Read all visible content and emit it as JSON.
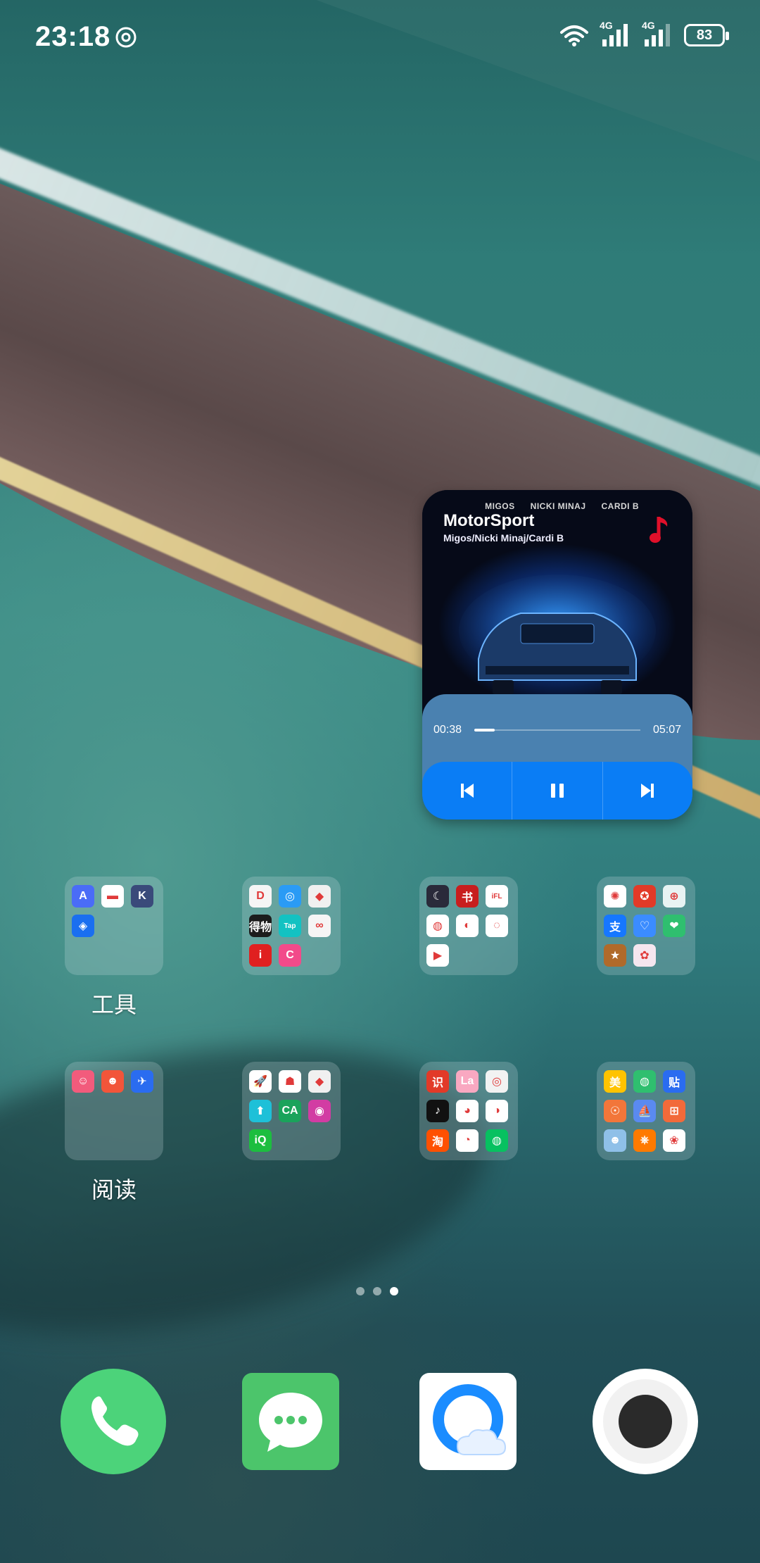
{
  "status_bar": {
    "time": "23:18",
    "network_label_1": "4G",
    "network_label_2": "4G",
    "battery": "83"
  },
  "music_widget": {
    "album_artists": [
      "MIGOS",
      "NICKI MINAJ",
      "CARDI B"
    ],
    "title": "MotorSport",
    "artist": "Migos/Nicki Minaj/Cardi B",
    "elapsed": "00:38",
    "duration": "05:07",
    "progress_fraction": 0.124,
    "accent_color": "#0a7df5"
  },
  "folders": [
    {
      "label": "工具",
      "icons": [
        {
          "name": "app-store-icon",
          "color": "#4a6cf7",
          "glyph": "A"
        },
        {
          "name": "card-app-icon",
          "color": "#ffffff",
          "glyph": "▬"
        },
        {
          "name": "k-app-icon",
          "color": "#3a4a7a",
          "glyph": "K"
        },
        {
          "name": "security-shield-icon",
          "color": "#1a6ff0",
          "glyph": "◈"
        }
      ]
    },
    {
      "label": "",
      "icons": [
        {
          "name": "didi-icon",
          "color": "#f5f5f5",
          "glyph": "D"
        },
        {
          "name": "compass-app-icon",
          "color": "#2a9bf5",
          "glyph": "◎"
        },
        {
          "name": "china-mobile-icon",
          "color": "#f0f0f0",
          "glyph": "◆"
        },
        {
          "name": "dewu-icon",
          "color": "#1c1c1c",
          "glyph": "得物"
        },
        {
          "name": "taptap-icon",
          "color": "#13c2c2",
          "glyph": "Tap"
        },
        {
          "name": "baidu-netdisk-icon",
          "color": "#f5f5f5",
          "glyph": "∞"
        },
        {
          "name": "isobar-icon",
          "color": "#e02020",
          "glyph": "i"
        },
        {
          "name": "pink-c-icon",
          "color": "#f24a8a",
          "glyph": "C"
        }
      ]
    },
    {
      "label": "",
      "icons": [
        {
          "name": "moon-app-icon",
          "color": "#2a2a3a",
          "glyph": "☾"
        },
        {
          "name": "red-calligraphy-icon",
          "color": "#c81e1e",
          "glyph": "书"
        },
        {
          "name": "ifly-icon",
          "color": "#ffffff",
          "glyph": "iFL"
        },
        {
          "name": "lotus-app-icon",
          "color": "#ffffff",
          "glyph": "◍"
        },
        {
          "name": "red-bird-icon",
          "color": "#ffffff",
          "glyph": "◐"
        },
        {
          "name": "kiwi-app-icon",
          "color": "#ffffff",
          "glyph": "◌"
        },
        {
          "name": "play-icon",
          "color": "#ffffff",
          "glyph": "▶"
        }
      ]
    },
    {
      "label": "",
      "icons": [
        {
          "name": "pinwheel-icon",
          "color": "#ffffff",
          "glyph": "✺"
        },
        {
          "name": "redstar-news-icon",
          "color": "#e23a28",
          "glyph": "✪"
        },
        {
          "name": "planet-app-icon",
          "color": "#e8f3f3",
          "glyph": "⊕"
        },
        {
          "name": "alipay-icon",
          "color": "#1677ff",
          "glyph": "支"
        },
        {
          "name": "heart-app-icon",
          "color": "#3b8cff",
          "glyph": "♡"
        },
        {
          "name": "green-heart-icon",
          "color": "#2fbf6f",
          "glyph": "❤"
        },
        {
          "name": "game-icon",
          "color": "#b06a2a",
          "glyph": "★"
        },
        {
          "name": "anime-girl-icon",
          "color": "#f5e6ef",
          "glyph": "✿"
        }
      ]
    },
    {
      "label": "阅读",
      "icons": [
        {
          "name": "cartoon-face-icon",
          "color": "#f25b7c",
          "glyph": "☺"
        },
        {
          "name": "comic-app-icon",
          "color": "#f2553a",
          "glyph": "☻"
        },
        {
          "name": "blue-bird-icon",
          "color": "#2a6cf0",
          "glyph": "✈"
        }
      ]
    },
    {
      "label": "",
      "icons": [
        {
          "name": "rocket-app-icon",
          "color": "#ffffff",
          "glyph": "🚀"
        },
        {
          "name": "man-avatar-icon",
          "color": "#ffffff",
          "glyph": "☗"
        },
        {
          "name": "china-mobile-2-icon",
          "color": "#f0f0f0",
          "glyph": "◆"
        },
        {
          "name": "arrow-up-icon",
          "color": "#1ec0d8",
          "glyph": "⬆"
        },
        {
          "name": "ca-icon",
          "color": "#1aa35b",
          "glyph": "CA"
        },
        {
          "name": "purple-app-icon",
          "color": "#d23ca3",
          "glyph": "◉"
        },
        {
          "name": "iqiyi-icon",
          "color": "#1cbe3f",
          "glyph": "iQ"
        }
      ]
    },
    {
      "label": "",
      "icons": [
        {
          "name": "shi-app-icon",
          "color": "#e23a28",
          "glyph": "识"
        },
        {
          "name": "lala-app-icon",
          "color": "#f9a8c1",
          "glyph": "La"
        },
        {
          "name": "netease-music-icon",
          "color": "#f2f2f2",
          "glyph": "◎"
        },
        {
          "name": "tiktok-icon",
          "color": "#111111",
          "glyph": "♪"
        },
        {
          "name": "weibo-icon",
          "color": "#ffffff",
          "glyph": "◕"
        },
        {
          "name": "qq-icon",
          "color": "#ffffff",
          "glyph": "◑"
        },
        {
          "name": "taobao-icon",
          "color": "#ff5000",
          "glyph": "淘"
        },
        {
          "name": "xianyu-icon",
          "color": "#ffffff",
          "glyph": "◔"
        },
        {
          "name": "wechat-icon",
          "color": "#07c160",
          "glyph": "◍"
        }
      ]
    },
    {
      "label": "",
      "icons": [
        {
          "name": "meituan-icon",
          "color": "#ffc300",
          "glyph": "美"
        },
        {
          "name": "speech-bubble-icon",
          "color": "#2fbf6f",
          "glyph": "◍"
        },
        {
          "name": "tieba-icon",
          "color": "#2a6cf0",
          "glyph": "贴"
        },
        {
          "name": "fox-app-icon",
          "color": "#f2763a",
          "glyph": "☉"
        },
        {
          "name": "sailboat-icon",
          "color": "#5a8af0",
          "glyph": "⛵"
        },
        {
          "name": "gamepad-icon",
          "color": "#f26a3a",
          "glyph": "⊞"
        },
        {
          "name": "character-game-icon",
          "color": "#8fc0e8",
          "glyph": "☻"
        },
        {
          "name": "kuaishou-icon",
          "color": "#ff7a00",
          "glyph": "⎈"
        },
        {
          "name": "colorful-app-icon",
          "color": "#ffffff",
          "glyph": "❀"
        }
      ]
    }
  ],
  "page_indicator": {
    "count": 3,
    "active": 3
  },
  "dock": [
    {
      "name": "phone",
      "color": "#4cd37a"
    },
    {
      "name": "messages",
      "color": "#4cc56b"
    },
    {
      "name": "qq-browser",
      "color": "#ffffff"
    },
    {
      "name": "camera",
      "color": "#ffffff"
    }
  ]
}
